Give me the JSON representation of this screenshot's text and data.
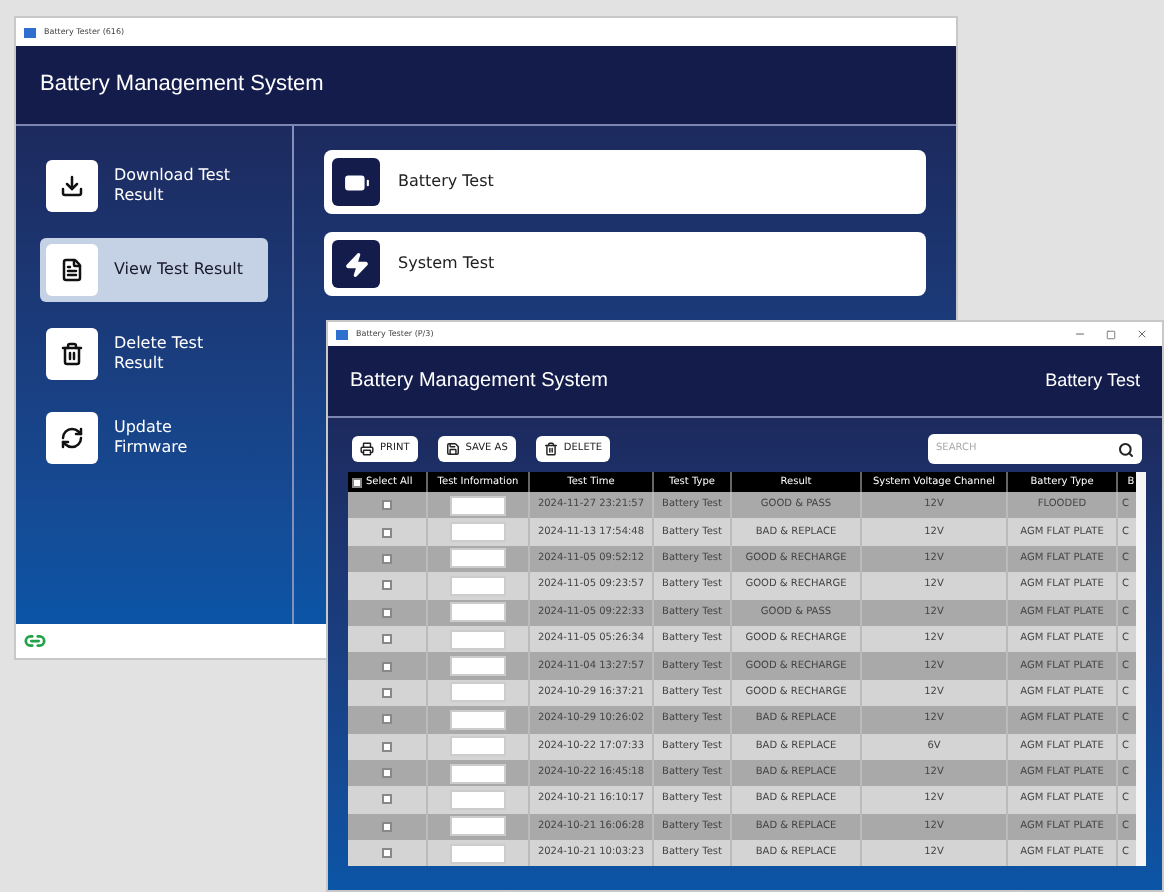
{
  "back_window": {
    "title": "Battery Tester (616)",
    "header": "Battery Management System",
    "sidebar": {
      "items": [
        {
          "kind": "download",
          "label": "Download Test Result",
          "selected": false
        },
        {
          "kind": "document",
          "label": "View Test Result",
          "selected": true
        },
        {
          "kind": "trash",
          "label": "Delete Test Result",
          "selected": false
        },
        {
          "kind": "refresh",
          "label": "Update Firmware",
          "selected": false
        }
      ]
    },
    "actions": [
      {
        "kind": "battery",
        "label": "Battery Test"
      },
      {
        "kind": "bolt",
        "label": "System Test"
      }
    ]
  },
  "front_window": {
    "title": "Battery Tester (P/3)",
    "header": "Battery Management System",
    "section": "Battery Test",
    "toolbar": [
      {
        "kind": "print",
        "label": "PRINT"
      },
      {
        "kind": "save",
        "label": "SAVE AS"
      },
      {
        "kind": "delete",
        "label": "DELETE"
      }
    ],
    "search": {
      "placeholder": "SEARCH"
    },
    "table": {
      "select_all": {
        "checked": false
      },
      "columns": [
        "Select All",
        "Test Information",
        "Test Time",
        "Test Type",
        "Result",
        "System Voltage Channel",
        "Battery Type",
        "B"
      ],
      "rows": [
        {
          "checked": false,
          "cells": [
            "",
            "",
            "2024-11-27 23:21:57",
            "Battery Test",
            "GOOD & PASS",
            "12V",
            "FLOODED",
            "C"
          ]
        },
        {
          "checked": false,
          "cells": [
            "",
            "",
            "2024-11-13 17:54:48",
            "Battery Test",
            "BAD & REPLACE",
            "12V",
            "AGM FLAT PLATE",
            "C"
          ]
        },
        {
          "checked": false,
          "cells": [
            "",
            "",
            "2024-11-05 09:52:12",
            "Battery Test",
            "GOOD & RECHARGE",
            "12V",
            "AGM FLAT PLATE",
            "C"
          ]
        },
        {
          "checked": false,
          "cells": [
            "",
            "",
            "2024-11-05 09:23:57",
            "Battery Test",
            "GOOD & RECHARGE",
            "12V",
            "AGM FLAT PLATE",
            "C"
          ]
        },
        {
          "checked": false,
          "cells": [
            "",
            "",
            "2024-11-05 09:22:33",
            "Battery Test",
            "GOOD & PASS",
            "12V",
            "AGM FLAT PLATE",
            "C"
          ]
        },
        {
          "checked": false,
          "cells": [
            "",
            "",
            "2024-11-05 05:26:34",
            "Battery Test",
            "GOOD & RECHARGE",
            "12V",
            "AGM FLAT PLATE",
            "C"
          ]
        },
        {
          "checked": false,
          "cells": [
            "",
            "",
            "2024-11-04 13:27:57",
            "Battery Test",
            "GOOD & RECHARGE",
            "12V",
            "AGM FLAT PLATE",
            "C"
          ]
        },
        {
          "checked": false,
          "cells": [
            "",
            "",
            "2024-10-29 16:37:21",
            "Battery Test",
            "GOOD & RECHARGE",
            "12V",
            "AGM FLAT PLATE",
            "C"
          ]
        },
        {
          "checked": false,
          "cells": [
            "",
            "",
            "2024-10-29 10:26:02",
            "Battery Test",
            "BAD & REPLACE",
            "12V",
            "AGM FLAT PLATE",
            "C"
          ]
        },
        {
          "checked": false,
          "cells": [
            "",
            "",
            "2024-10-22 17:07:33",
            "Battery Test",
            "BAD & REPLACE",
            "6V",
            "AGM FLAT PLATE",
            "C"
          ]
        },
        {
          "checked": false,
          "cells": [
            "",
            "",
            "2024-10-22 16:45:18",
            "Battery Test",
            "BAD & REPLACE",
            "12V",
            "AGM FLAT PLATE",
            "C"
          ]
        },
        {
          "checked": false,
          "cells": [
            "",
            "",
            "2024-10-21 16:10:17",
            "Battery Test",
            "BAD & REPLACE",
            "12V",
            "AGM FLAT PLATE",
            "C"
          ]
        },
        {
          "checked": false,
          "cells": [
            "",
            "",
            "2024-10-21 16:06:28",
            "Battery Test",
            "BAD & REPLACE",
            "12V",
            "AGM FLAT PLATE",
            "C"
          ]
        },
        {
          "checked": false,
          "cells": [
            "",
            "",
            "2024-10-21 10:03:23",
            "Battery Test",
            "BAD & REPLACE",
            "12V",
            "AGM FLAT PLATE",
            "C"
          ]
        }
      ]
    }
  }
}
